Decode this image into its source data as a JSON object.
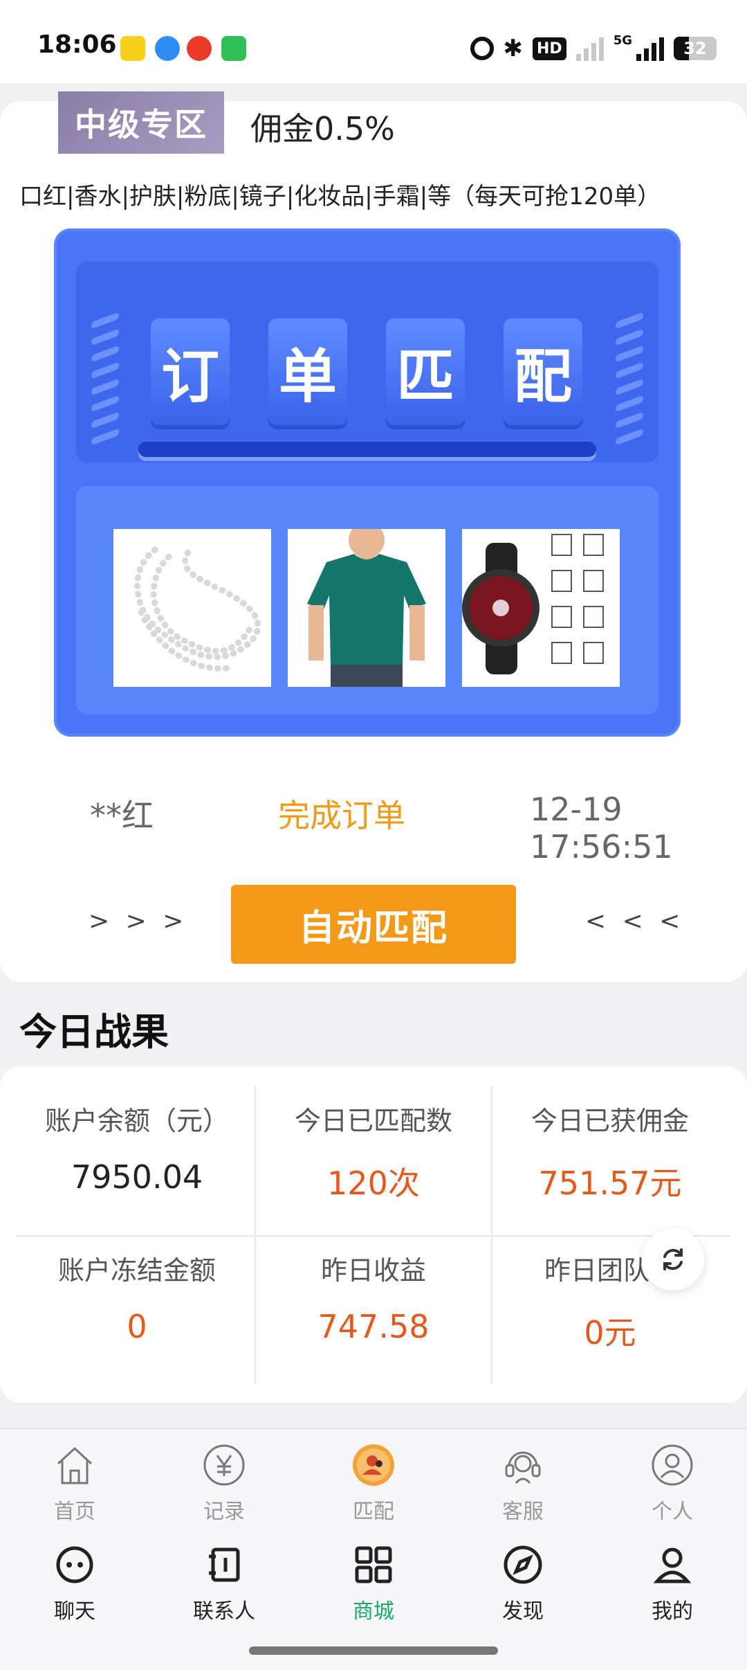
{
  "status_bar": {
    "time": "18:06",
    "hd_label": "HD",
    "net_label": "5G",
    "battery": "32"
  },
  "zone": {
    "badge": "中级专区",
    "commission": "佣金0.5%",
    "categories": "口红|香水|护肤|粉底|镜子|化妆品|手霜|等（每天可抢120单）"
  },
  "matcher": {
    "chars": [
      "订",
      "单",
      "匹",
      "配"
    ],
    "products": [
      "pearl-necklace",
      "green-tshirt",
      "smartwatch-screen-protector"
    ]
  },
  "order": {
    "user": "**红",
    "status": "完成订单",
    "time": "12-19 17:56:51"
  },
  "auto_button": "自动匹配",
  "arrows_left": "> > >",
  "arrows_right": "< < <",
  "section_title": "今日战果",
  "stats": [
    {
      "label": "账户余额（元）",
      "value": "7950.04"
    },
    {
      "label": "今日已匹配数",
      "value": "120次"
    },
    {
      "label": "今日已获佣金",
      "value": "751.57元"
    },
    {
      "label": "账户冻结金额",
      "value": "0"
    },
    {
      "label": "昨日收益",
      "value": "747.58"
    },
    {
      "label": "昨日团队佣",
      "value": "0元"
    }
  ],
  "inner_nav": [
    "首页",
    "记录",
    "匹配",
    "客服",
    "个人"
  ],
  "outer_nav": [
    "聊天",
    "联系人",
    "商城",
    "发现",
    "我的"
  ],
  "colors": {
    "accent_orange": "#f29a17",
    "value_orange": "#e55a1c",
    "matcher_blue": "#4a73f5",
    "active_green": "#19a86a"
  }
}
